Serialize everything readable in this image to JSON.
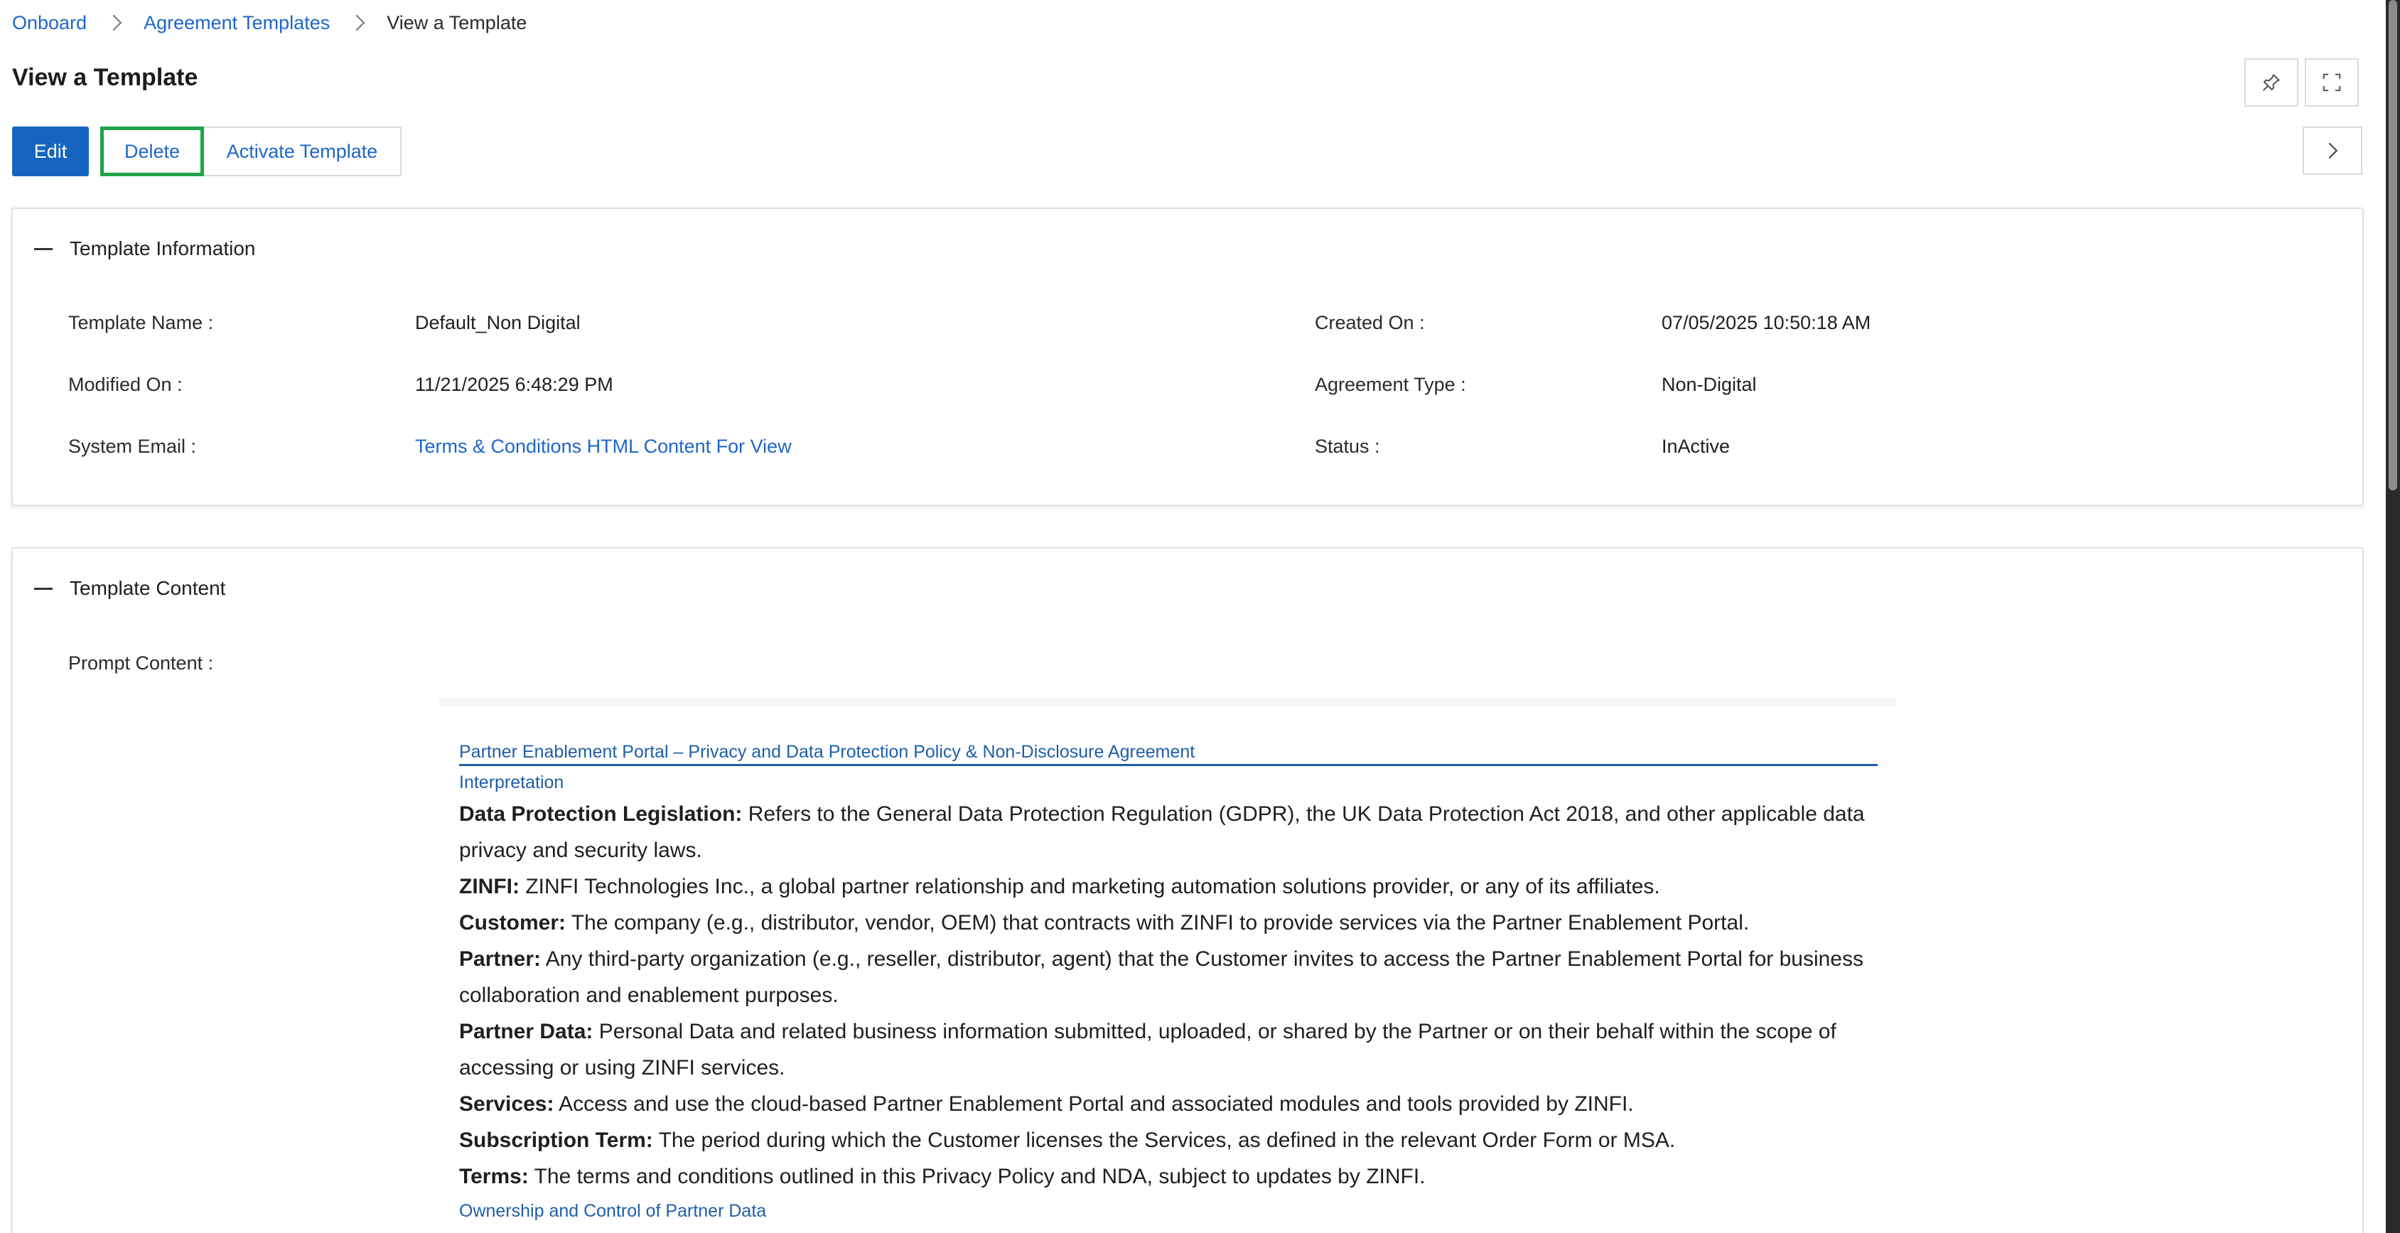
{
  "breadcrumb": {
    "items": [
      "Onboard",
      "Agreement Templates"
    ],
    "current": "View a Template"
  },
  "page": {
    "title": "View a Template"
  },
  "toolbar": {
    "edit_label": "Edit",
    "delete_label": "Delete",
    "activate_label": "Activate Template"
  },
  "template_info": {
    "section_title": "Template Information",
    "fields": [
      {
        "label": "Template Name :",
        "value": "Default_Non Digital"
      },
      {
        "label": "Created On :",
        "value": "07/05/2025 10:50:18 AM"
      },
      {
        "label": "Modified On :",
        "value": "11/21/2025 6:48:29 PM"
      },
      {
        "label": "Agreement Type :",
        "value": "Non-Digital"
      },
      {
        "label": "System Email :",
        "value": "Terms & Conditions HTML Content For View"
      },
      {
        "label": "Status :",
        "value": "InActive"
      }
    ]
  },
  "template_content": {
    "section_title": "Template Content",
    "prompt_label": "Prompt Content :",
    "document": {
      "title": "Partner Enablement Portal – Privacy and Data Protection Policy & Non-Disclosure Agreement",
      "heading1": "Interpretation",
      "definitions": [
        {
          "term": "Data Protection Legislation:",
          "text": " Refers to the General Data Protection Regulation (GDPR), the UK Data Protection Act 2018, and other applicable data privacy and security laws."
        },
        {
          "term": "ZINFI:",
          "text": " ZINFI Technologies Inc., a global partner relationship and marketing automation solutions provider, or any of its affiliates."
        },
        {
          "term": "Customer:",
          "text": " The company (e.g., distributor, vendor, OEM) that contracts with ZINFI to provide services via the Partner Enablement Portal."
        },
        {
          "term": "Partner:",
          "text": " Any third-party organization (e.g., reseller, distributor, agent) that the Customer invites to access the Partner Enablement Portal for business collaboration and enablement purposes."
        },
        {
          "term": "Partner Data:",
          "text": " Personal Data and related business information submitted, uploaded, or shared by the Partner or on their behalf within the scope of accessing or using ZINFI services."
        },
        {
          "term": "Services:",
          "text": " Access and use the cloud-based Partner Enablement Portal and associated modules and tools provided by ZINFI."
        },
        {
          "term": "Subscription Term:",
          "text": " The period during which the Customer licenses the Services, as defined in the relevant Order Form or MSA."
        },
        {
          "term": "Terms:",
          "text": " The terms and conditions outlined in this Privacy Policy and NDA, subject to updates by ZINFI."
        }
      ],
      "heading2": "Ownership and Control of Partner Data"
    }
  },
  "colors": {
    "primary": "#1565c0",
    "link": "#1f66c8",
    "highlight": "#1fa34a"
  },
  "icons": [
    "chevron-right-icon",
    "pin-icon",
    "fullscreen-icon",
    "collapse-icon"
  ]
}
